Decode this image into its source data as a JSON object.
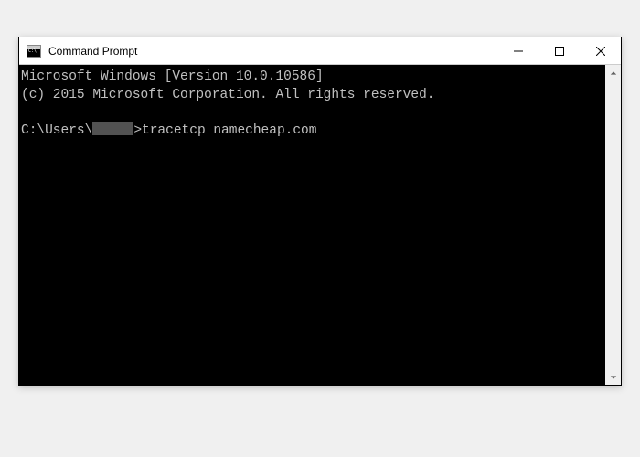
{
  "window": {
    "title": "Command Prompt"
  },
  "console": {
    "line1": "Microsoft Windows [Version 10.0.10586]",
    "line2": "(c) 2015 Microsoft Corporation. All rights reserved.",
    "prompt_prefix": "C:\\Users\\",
    "prompt_suffix": ">",
    "command": "tracetcp namecheap.com"
  }
}
